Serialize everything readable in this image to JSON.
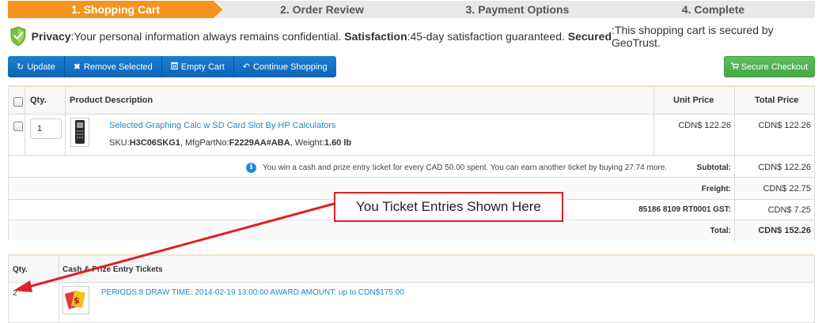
{
  "steps": [
    {
      "label": "1. Shopping Cart",
      "active": true
    },
    {
      "label": "2. Order Review",
      "active": false
    },
    {
      "label": "3. Payment Options",
      "active": false
    },
    {
      "label": "4. Complete",
      "active": false
    }
  ],
  "privacy": {
    "privacy_label": "Privacy",
    "privacy_text": ":Your personal information always remains confidential. ",
    "satisfaction_label": "Satisfaction",
    "satisfaction_text": ":45-day satisfaction guaranteed. ",
    "secured_label": "Secured",
    "secured_text": ":This shopping cart is secured by GeoTrust."
  },
  "toolbar": {
    "update_label": "Update",
    "remove_label": "Remove Selected",
    "empty_label": "Empty Cart",
    "continue_label": "Continue Shopping",
    "checkout_label": "Secure Checkout"
  },
  "cart": {
    "headers": {
      "qty": "Qty.",
      "description": "Product Description",
      "unit_price": "Unit Price",
      "total_price": "Total Price"
    },
    "item": {
      "qty": "1",
      "name": "Selected Graphing Calc w SD Card Slot By HP Calculators",
      "sku_label": "SKU:",
      "sku": "H3C06SKG1",
      "mfg_label": ", MfgPartNo:",
      "mfg": "F2229AA#ABA",
      "weight_label": ", Weight:",
      "weight": "1.60 lb",
      "unit_price": "CDN$ 122.26",
      "total_price": "CDN$ 122.26"
    },
    "notice": "You win a cash and prize entry ticket for every CAD 50.00 spent. You can earn another ticket by buying 27.74 more.",
    "subtotal_label": "Subtotal:",
    "subtotal": "CDN$ 122.26",
    "freight_label": "Freight:",
    "freight": "CDN$ 22.75",
    "gst_label": "85186 8109 RT0001 GST:",
    "gst": "CDN$ 7.25",
    "total_label": "Total:",
    "total": "CDN$ 152.26"
  },
  "tickets": {
    "headers": {
      "qty": "Qty.",
      "title": "Cash & Prize Entry Tickets"
    },
    "qty": "2",
    "description": "PERIODS:8 DRAW TIME: 2014-02-19 13:00:00 AWARD AMOUNT: up to CDN$175.00"
  },
  "callout": {
    "text": "You Ticket Entries Shown Here"
  },
  "colors": {
    "active_step": "#f7941d",
    "inactive_step": "#e6e6e6",
    "primary_button": "#1570c5",
    "checkout_button": "#52b552",
    "link": "#1e88cc",
    "callout_border": "#e02020"
  }
}
